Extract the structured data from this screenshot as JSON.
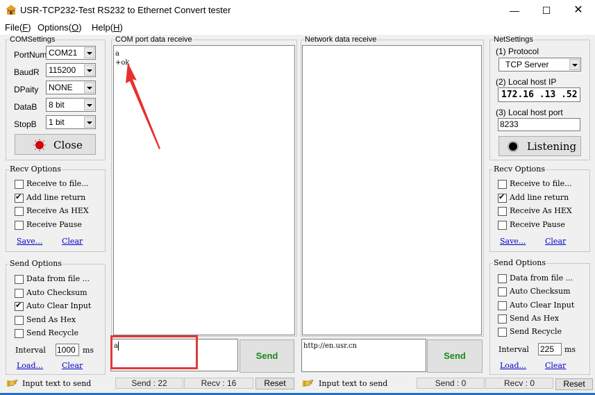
{
  "window": {
    "title": "USR-TCP232-Test  RS232 to Ethernet Convert tester",
    "icon": "app-house-icon",
    "controls": [
      "minimize",
      "maximize",
      "close"
    ]
  },
  "menu": [
    {
      "label": "File(",
      "key": "F",
      "suffix": ")"
    },
    {
      "label": "Options(",
      "key": "O",
      "suffix": ")"
    },
    {
      "label": "Help(",
      "key": "H",
      "suffix": ")"
    }
  ],
  "com_settings": {
    "title": "COMSettings",
    "fields": [
      {
        "label": "PortNum",
        "value": "COM21"
      },
      {
        "label": "BaudR",
        "value": "115200"
      },
      {
        "label": "DPaity",
        "value": "NONE"
      },
      {
        "label": "DataB",
        "value": "8 bit"
      },
      {
        "label": "StopB",
        "value": "1 bit"
      }
    ],
    "button": {
      "label": "Close",
      "indicator_color": "#e00000"
    }
  },
  "left_recv_options": {
    "title": "Recv Options",
    "options": [
      {
        "label": "Receive to file...",
        "checked": false
      },
      {
        "label": "Add line return",
        "checked": true
      },
      {
        "label": "Receive As HEX",
        "checked": false
      },
      {
        "label": "Receive Pause",
        "checked": false
      }
    ],
    "save_link": "Save...",
    "clear_link": "Clear"
  },
  "left_send_options": {
    "title": "Send Options",
    "options": [
      {
        "label": "Data from file ...",
        "checked": false
      },
      {
        "label": "Auto Checksum",
        "checked": false
      },
      {
        "label": "Auto Clear Input",
        "checked": true
      },
      {
        "label": "Send As Hex",
        "checked": false
      },
      {
        "label": "Send Recycle",
        "checked": false
      }
    ],
    "interval_label": "Interval",
    "interval_value": "1000",
    "interval_unit": "ms",
    "load_link": "Load...",
    "clear_link": "Clear"
  },
  "com_receive": {
    "title": "COM port data receive",
    "lines": [
      "a",
      "+ok"
    ]
  },
  "com_send": {
    "input_value": "a",
    "send_label": "Send",
    "send_count": "Send : 22",
    "recv_count": "Recv : 16",
    "reset_label": "Reset",
    "hint": "Input text to send",
    "highlight_color": "#e03030"
  },
  "net_receive": {
    "title": "Network data receive",
    "lines": []
  },
  "net_send": {
    "input_value": "http://en.usr.cn",
    "send_label": "Send",
    "send_count": "Send : 0",
    "recv_count": "Recv : 0",
    "reset_label": "Reset",
    "hint": "Input text to send"
  },
  "net_settings": {
    "title": "NetSettings",
    "protocol_label": "(1) Protocol",
    "protocol_value": "TCP Server",
    "ip_label": "(2) Local host IP",
    "ip_value": "172.16 .13 .52",
    "port_label": "(3) Local host port",
    "port_value": "8233",
    "button_label": "Listening"
  },
  "right_recv_options": {
    "title": "Recv Options",
    "options": [
      {
        "label": "Receive to file...",
        "checked": false
      },
      {
        "label": "Add line return",
        "checked": true
      },
      {
        "label": "Receive As HEX",
        "checked": false
      },
      {
        "label": "Receive Pause",
        "checked": false
      }
    ],
    "save_link": "Save...",
    "clear_link": "Clear"
  },
  "right_send_options": {
    "title": "Send Options",
    "options": [
      {
        "label": "Data from file ...",
        "checked": false
      },
      {
        "label": "Auto Checksum",
        "checked": false
      },
      {
        "label": "Auto Clear Input",
        "checked": false
      },
      {
        "label": "Send As Hex",
        "checked": false
      },
      {
        "label": "Send Recycle",
        "checked": false
      }
    ],
    "interval_label": "Interval",
    "interval_value": "225",
    "interval_unit": "ms",
    "load_link": "Load...",
    "clear_link": "Clear"
  }
}
